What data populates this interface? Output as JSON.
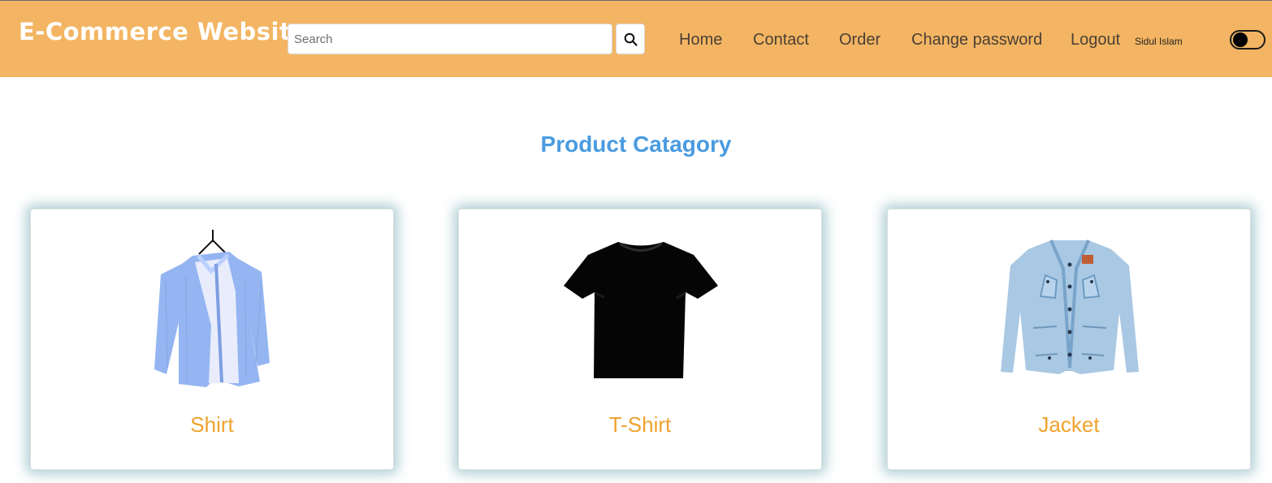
{
  "header": {
    "brand": "E-Commerce Website",
    "search": {
      "placeholder": "Search",
      "value": "",
      "button_icon": "search-icon"
    },
    "nav": {
      "home": "Home",
      "contact": "Contact",
      "order": "Order",
      "change_password": "Change password",
      "logout": "Logout"
    },
    "username": "Sidul Islam",
    "theme_toggle_on": false
  },
  "main": {
    "title": "Product Catagory",
    "categories": [
      {
        "label": "Shirt",
        "image": "light-blue-shirt-on-hanger"
      },
      {
        "label": "T-Shirt",
        "image": "black-t-shirt"
      },
      {
        "label": "Jacket",
        "image": "light-denim-jacket"
      }
    ]
  },
  "colors": {
    "navbar_background": "#f3b563",
    "brand_text": "#ffffff",
    "nav_text": "#4a4035",
    "title_blue": "#4a9be0",
    "category_orange": "#f0a22e",
    "card_shadow": "#6ea5af"
  }
}
